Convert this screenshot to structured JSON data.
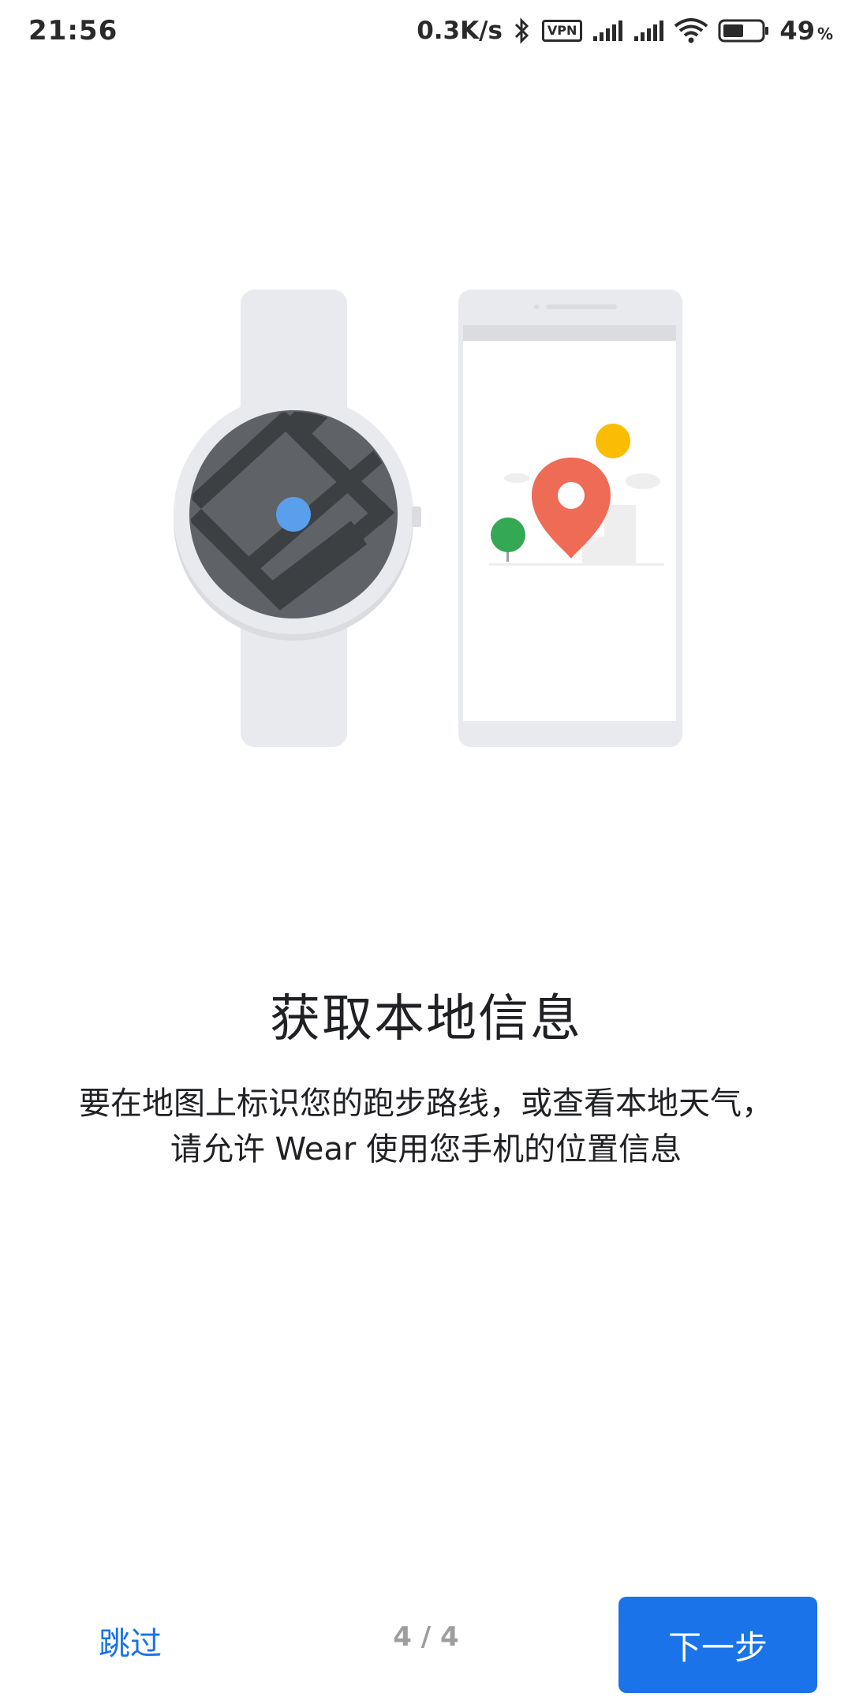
{
  "status_bar": {
    "time": "21:56",
    "net_speed": "0.3K/s",
    "vpn_label": "VPN",
    "battery": "49",
    "battery_unit": "%"
  },
  "illustration": {
    "watch_icon": "smartwatch-map-icon",
    "phone_icon": "phone-location-icon",
    "colors": {
      "pin": "#EE6B56",
      "sun": "#FBBC04",
      "tree": "#34A853",
      "location_dot": "#5A9FEB",
      "device_body": "#E8EAED"
    }
  },
  "content": {
    "title": "获取本地信息",
    "description_line1": "要在地图上标识您的跑步路线，或查看本地天气，",
    "description_line2": "请允许 Wear 使用您手机的位置信息"
  },
  "footer": {
    "skip_label": "跳过",
    "page_indicator": "4 / 4",
    "next_label": "下一步"
  }
}
